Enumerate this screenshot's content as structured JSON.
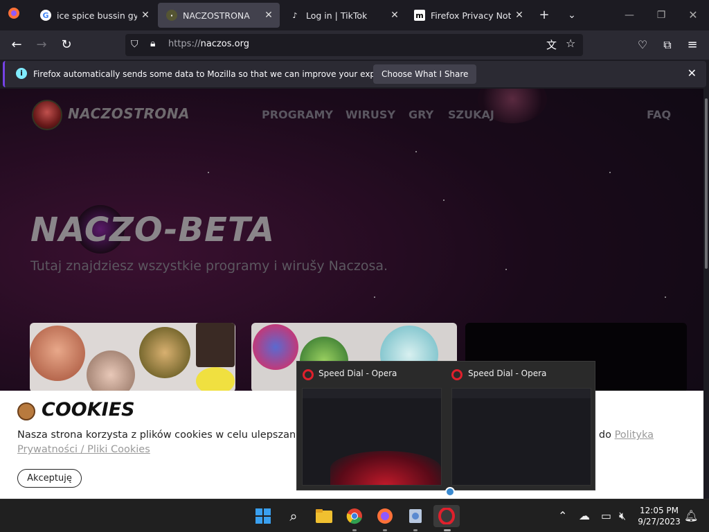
{
  "browser": {
    "tabs": [
      {
        "title": "ice spice bussin gyatt -",
        "icon": "google-icon",
        "active": false
      },
      {
        "title": "NACZOSTRONA",
        "icon": "naczostrona-icon",
        "active": true
      },
      {
        "title": "Log in | TikTok",
        "icon": "tiktok-icon",
        "active": false
      },
      {
        "title": "Firefox Privacy Notice —",
        "icon": "mozilla-icon",
        "active": false
      }
    ],
    "url_protocol": "https://",
    "url_host": "naczos.org",
    "notification": {
      "text": "Firefox automatically sends some data to Mozilla so that we can improve your experience.",
      "button": "Choose What I Share"
    }
  },
  "site": {
    "logo_text": "NACZOSTRONA",
    "nav": [
      "PROGRAMY",
      "WIRUSY",
      "GRY",
      "SZUKAJ"
    ],
    "faq": "FAQ",
    "hero_title": "NACZO-BETA",
    "hero_subtitle": "Tutaj znajdziesz wszystkie programy i wirušy Naczosa."
  },
  "cookies": {
    "title": "COOKIES",
    "text_before": "Nasza strona korzysta z plików cookies w celu ulepszania c",
    "text_after": "ż do ",
    "link": "Polityka Prywatności / Pliki Cookies",
    "button": "Akceptuję"
  },
  "taskbar_preview": {
    "windows": [
      {
        "title": "Speed Dial - Opera"
      },
      {
        "title": "Speed Dial - Opera"
      }
    ]
  },
  "taskbar": {
    "time": "12:05 PM",
    "date": "9/27/2023"
  },
  "colors": {
    "firefox_dark": "#1c1b22",
    "toolbar": "#2b2a33",
    "opera_red": "#e0202c",
    "accent_purple": "#7542e5"
  }
}
